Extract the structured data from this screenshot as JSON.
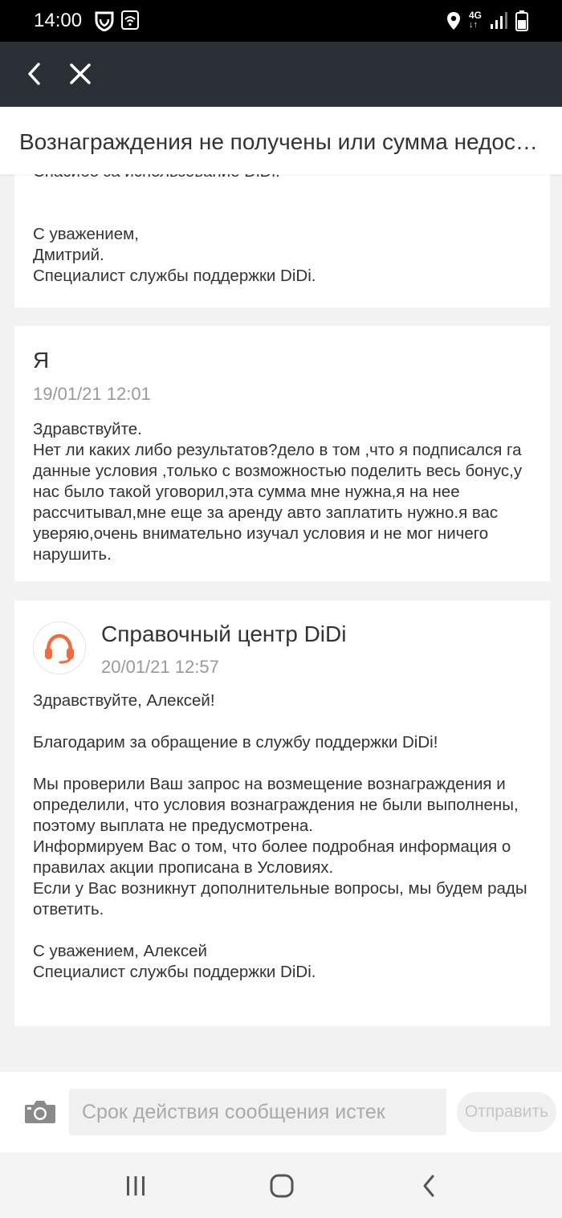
{
  "status_bar": {
    "time": "14:00",
    "network": "4G",
    "icons": [
      "shield-icon",
      "wifi-icon",
      "location-icon",
      "signal-icon",
      "battery-icon"
    ]
  },
  "nav": {
    "back_icon": "chevron-left-icon",
    "close_icon": "close-icon"
  },
  "title": "Вознаграждения не получены или сумма недостаточна",
  "messages": [
    {
      "body": "Спасибо за использование DiDi.\n\n\nС уважением,\nДмитрий.\nСпециалист службы поддержки DiDi."
    },
    {
      "author": "Я",
      "time": "19/01/21 12:01",
      "body": "Здравствуйте.\nНет ли каких либо результатов?дело в том ,что я подписался га данные условия ,только с возможностью поделить весь бонус,у нас было такой уговорил,эта сумма мне нужна,я на нее рассчитывал,мне еще за аренду авто заплатить нужно.я вас уверяю,очень внимательно изучал условия и не мог ничего нарушить."
    },
    {
      "author": "Справочный центр DiDi",
      "time": "20/01/21 12:57",
      "avatar_icon": "headset-icon",
      "body": "Здравствуйте, Алексей!\n\nБлагодарим за обращение в службу поддержки DiDi!\n\nМы проверили Ваш запрос на возмещение вознаграждения и определили, что условия вознаграждения не были выполнены, поэтому выплата не предусмотрена.\nИнформируем Вас о том, что более подробная информация о правилах акции прописана в Условиях.\nЕсли у Вас возникнут дополнительные вопросы, мы будем рады ответить.\n\nС уважением, Алексей\nСпециалист службы поддержки DiDi."
    }
  ],
  "input": {
    "placeholder": "Срок действия сообщения истек",
    "send_label": "Отправить",
    "camera_icon": "camera-icon"
  },
  "system_nav": {
    "icons": [
      "recent-apps-icon",
      "home-icon",
      "back-icon"
    ]
  },
  "colors": {
    "nav_bg": "#2b3036",
    "page_bg": "#f2f2f2",
    "accent": "#f26b3a"
  }
}
